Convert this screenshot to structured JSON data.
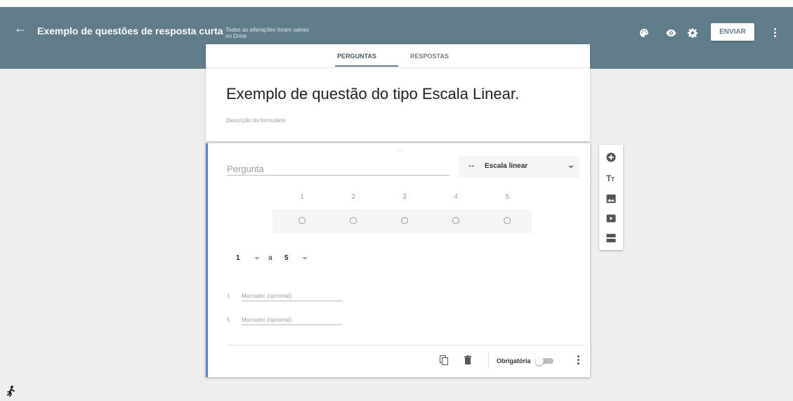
{
  "header": {
    "back_icon": "arrow-left-icon",
    "title": "Exemplo de questões de resposta curta",
    "save_status": "Todas as alterações foram salvas no Drive",
    "icons": [
      "palette-icon",
      "eye-icon",
      "gear-icon"
    ],
    "send_label": "ENVIAR",
    "more_icon": "more-vert-icon"
  },
  "tabs": [
    {
      "label": "PERGUNTAS",
      "active": true
    },
    {
      "label": "RESPOSTAS",
      "active": false
    }
  ],
  "form": {
    "title": "Exemplo de questão do tipo Escala Linear.",
    "description_placeholder": "Descrição do formulário"
  },
  "question": {
    "placeholder": "Pergunta",
    "type_label": "Escala linear",
    "scale_numbers": [
      "1",
      "2",
      "3",
      "4",
      "5"
    ],
    "range_from": "1",
    "range_word": "a",
    "range_to": "5",
    "label_min_num": "1",
    "label_max_num": "5",
    "label_placeholder": "Marcador (opcional)",
    "required_label": "Obrigatória",
    "required_on": false
  },
  "side_tools": [
    "add-question-icon",
    "title-text-icon",
    "image-icon",
    "video-icon",
    "section-icon"
  ],
  "colors": {
    "header": "#607d8b",
    "accent": "#4285f4",
    "background": "#eeeeee"
  }
}
